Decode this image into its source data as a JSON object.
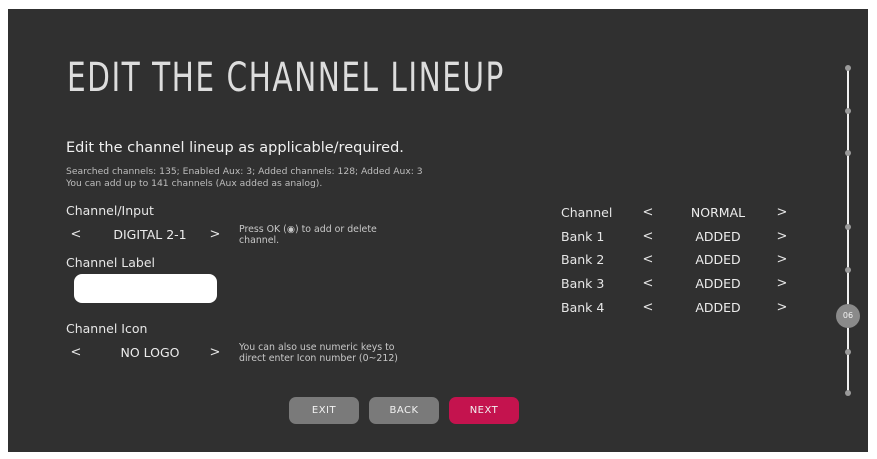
{
  "title": "EDIT THE CHANNEL LINEUP",
  "subtitle": "Edit the channel lineup as applicable/required.",
  "stats_line1": "Searched channels: 135; Enabled Aux: 3; Added channels: 128; Added Aux: 3",
  "stats_line2": "You can add up to 141 channels (Aux added as analog).",
  "channel_input": {
    "label": "Channel/Input",
    "value": "DIGITAL 2-1",
    "hint": "Press OK (◉) to add or delete channel."
  },
  "channel_label": {
    "label": "Channel Label",
    "value": "",
    "placeholder": ""
  },
  "channel_icon": {
    "label": "Channel Icon",
    "value": "NO LOGO",
    "hint": "You can also use numeric keys to direct enter Icon number (0~212)"
  },
  "arrows": {
    "left": "<",
    "right": ">"
  },
  "right_settings": [
    {
      "label": "Channel",
      "value": "NORMAL"
    },
    {
      "label": "Bank 1",
      "value": "ADDED"
    },
    {
      "label": "Bank 2",
      "value": "ADDED"
    },
    {
      "label": "Bank 3",
      "value": "ADDED"
    },
    {
      "label": "Bank 4",
      "value": "ADDED"
    }
  ],
  "buttons": {
    "exit": "EXIT",
    "back": "BACK",
    "next": "NEXT"
  },
  "progress": {
    "step": "06"
  },
  "colors": {
    "background": "#303030",
    "accent": "#c4134e",
    "button": "#7a7a7a"
  }
}
